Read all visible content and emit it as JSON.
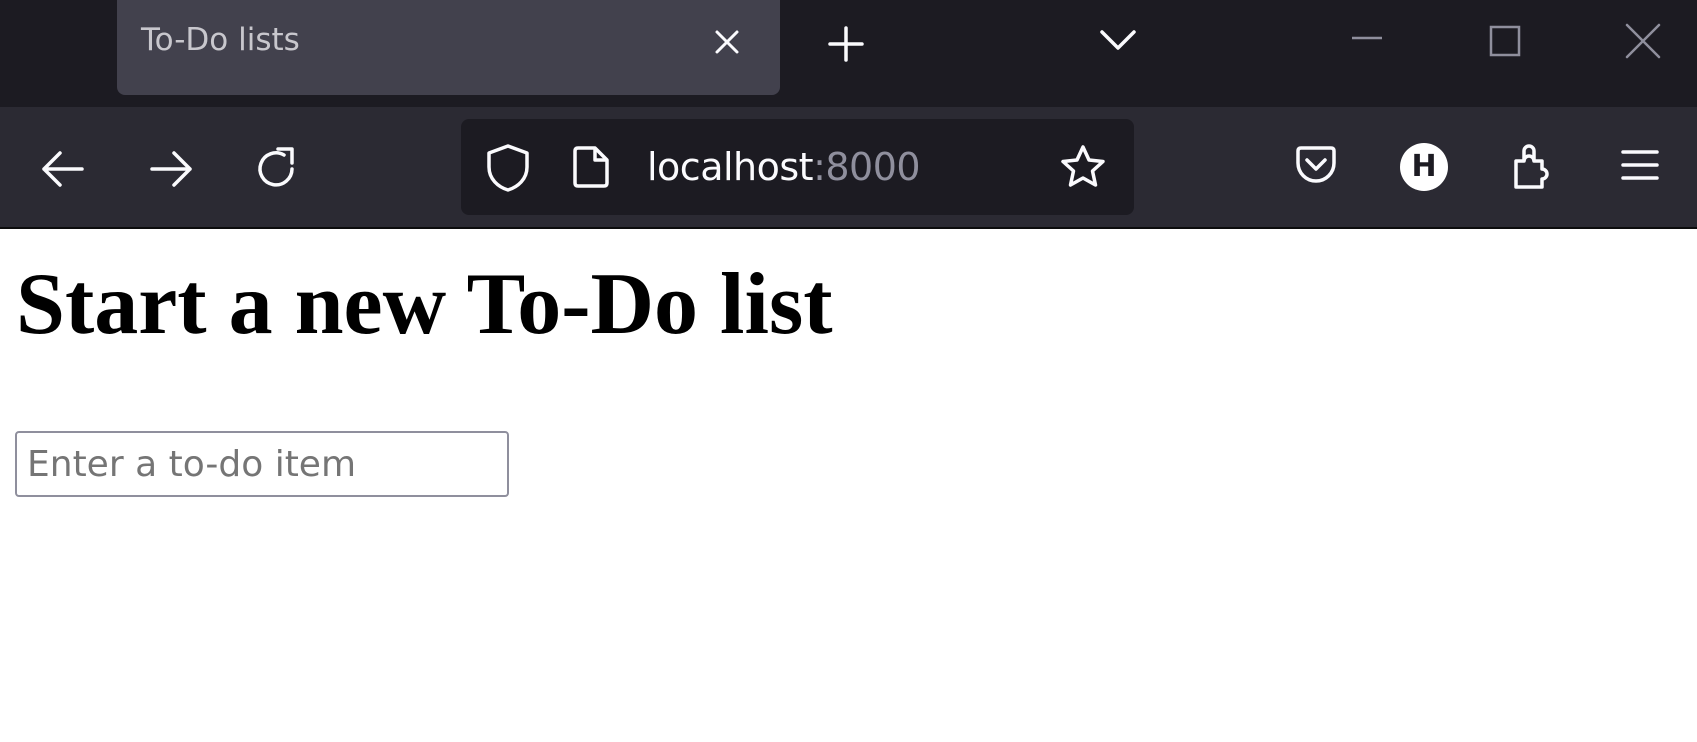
{
  "browser": {
    "tab": {
      "title": "To-Do lists"
    },
    "address_bar": {
      "host": "localhost",
      "port": ":8000"
    },
    "account": {
      "initial": "H"
    },
    "icons": {
      "tab_close": "close-icon",
      "new_tab": "plus-icon",
      "tab_list": "chevron-down-icon",
      "minimize": "minimize-icon",
      "maximize": "maximize-icon",
      "close_window": "close-icon",
      "back": "arrow-left-icon",
      "forward": "arrow-right-icon",
      "reload": "reload-icon",
      "tracking_protection": "shield-icon",
      "page_info": "page-icon",
      "bookmark": "star-icon",
      "pocket": "pocket-icon",
      "extensions": "puzzle-icon",
      "menu": "hamburger-menu-icon"
    },
    "colors": {
      "tabstrip_bg": "#1c1b22",
      "selected_tab_bg": "#42414d",
      "toolbar_bg": "#2b2a33",
      "urlbar_bg": "#1c1b22",
      "icon_fg": "#fbfbfe"
    }
  },
  "page": {
    "heading": "Start a new To-Do list",
    "new_item_input": {
      "placeholder": "Enter a to-do item",
      "value": ""
    }
  }
}
